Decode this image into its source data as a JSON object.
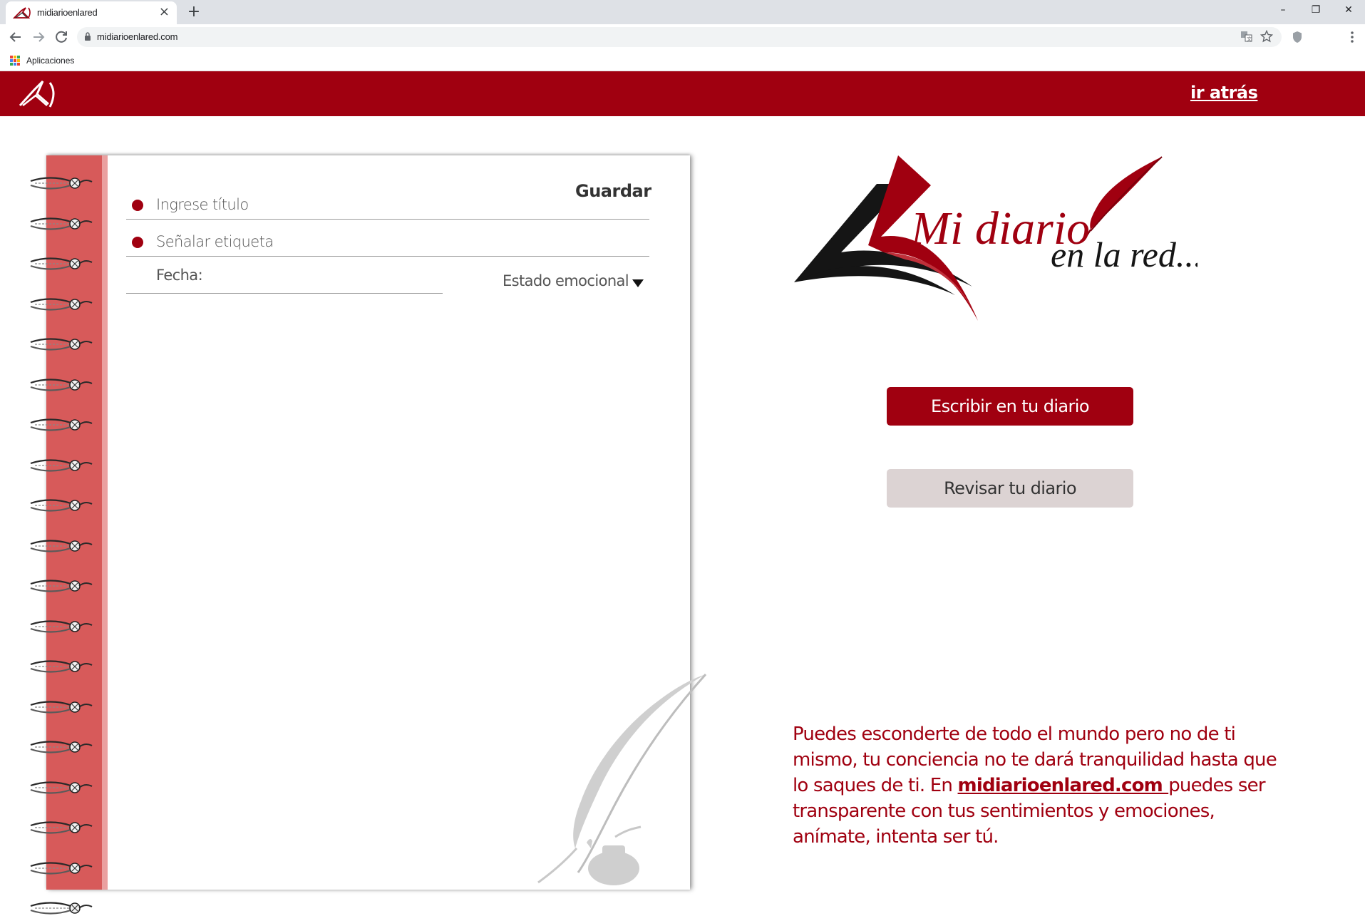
{
  "browser": {
    "tab_title": "midiarioenlared",
    "tab_close": "×",
    "new_tab": "+",
    "url": "midiarioenlared.com",
    "bookmarks_apps_label": "Aplicaciones",
    "window_controls": {
      "minimize": "–",
      "restore": "❐",
      "close": "✕"
    }
  },
  "header": {
    "back_link": "ir atrás",
    "bg_color": "#a00010"
  },
  "notebook": {
    "save_label": "Guardar",
    "title_placeholder": "Ingrese título",
    "tag_placeholder": "Señalar etiqueta",
    "date_label": "Fecha:",
    "mood_label": "Estado emocional"
  },
  "brand": {
    "logo_line1": "Mi diario",
    "logo_line2": "en la red..."
  },
  "actions": {
    "write_label": "Escribir en tu diario",
    "review_label": "Revisar tu diario"
  },
  "tagline": {
    "before": "Puedes esconderte de todo el mundo pero no de ti mismo, tu conciencia no te dará tranquilidad hasta que lo saques de ti. En ",
    "link": "midiarioenlared.com ",
    "after": "puedes ser transparente con tus sentimientos y emociones, anímate, intenta ser tú."
  },
  "colors": {
    "accent": "#a00010",
    "spiral_strip": "#d75a5a",
    "secondary_button": "#dcd3d3"
  }
}
